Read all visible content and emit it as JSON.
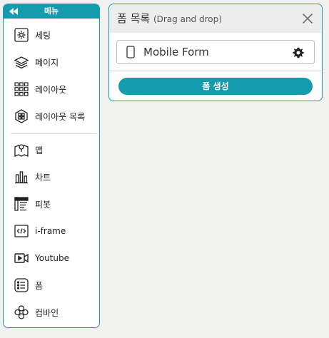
{
  "sidebar": {
    "title": "메뉴",
    "items": [
      {
        "label": "세팅",
        "icon": "gear-icon"
      },
      {
        "label": "페이지",
        "icon": "layers-icon"
      },
      {
        "label": "레이아웃",
        "icon": "grid-icon"
      },
      {
        "label": "레이아웃 목록",
        "icon": "hexagon-grid-icon"
      },
      {
        "label": "맵",
        "icon": "map-icon"
      },
      {
        "label": "차트",
        "icon": "bar-chart-icon"
      },
      {
        "label": "피봇",
        "icon": "pivot-icon"
      },
      {
        "label": "i-frame",
        "icon": "code-icon"
      },
      {
        "label": "Youtube",
        "icon": "video-icon"
      },
      {
        "label": "폼",
        "icon": "list-icon"
      },
      {
        "label": "컴바인",
        "icon": "combine-icon"
      }
    ]
  },
  "panel": {
    "title": "폼 목록",
    "subtitle": "(Drag and drop)",
    "form_item": "Mobile Form",
    "create_button": "폼 생성"
  },
  "colors": {
    "accent": "#149bad",
    "background": "#f1f1ef"
  }
}
